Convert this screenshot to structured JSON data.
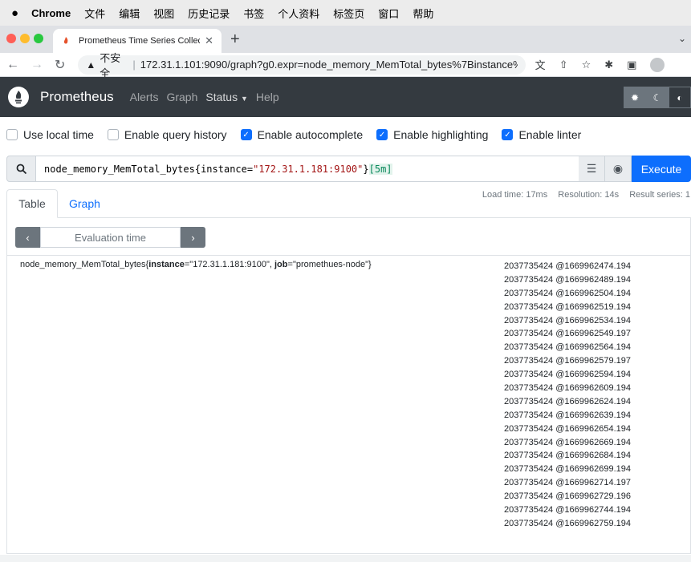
{
  "menubar": {
    "app": "Chrome",
    "items": [
      "文件",
      "编辑",
      "视图",
      "历史记录",
      "书签",
      "个人资料",
      "标签页",
      "窗口",
      "帮助"
    ]
  },
  "browser": {
    "tab_title": "Prometheus Time Series Collec",
    "security_label": "不安全",
    "url": "172.31.1.101:9090/graph?g0.expr=node_memory_MemTotal_bytes%7Binstance%3..."
  },
  "navbar": {
    "brand": "Prometheus",
    "links": {
      "alerts": "Alerts",
      "graph": "Graph",
      "status": "Status",
      "help": "Help"
    }
  },
  "options": {
    "use_local_time": {
      "label": "Use local time",
      "checked": false
    },
    "enable_query_history": {
      "label": "Enable query history",
      "checked": false
    },
    "enable_autocomplete": {
      "label": "Enable autocomplete",
      "checked": true
    },
    "enable_highlighting": {
      "label": "Enable highlighting",
      "checked": true
    },
    "enable_linter": {
      "label": "Enable linter",
      "checked": true
    }
  },
  "query": {
    "metric": "node_memory_MemTotal_bytes",
    "open_brace": "{",
    "label_name": "instance",
    "equals": "=",
    "label_value": "\"172.31.1.181:9100\"",
    "close_brace": "}",
    "range": "[5m]",
    "execute_label": "Execute"
  },
  "results": {
    "tabs": {
      "table": "Table",
      "graph": "Graph"
    },
    "load_time": "Load time: 17ms",
    "resolution": "Resolution: 14s",
    "result_series": "Result series: 1",
    "evaluation_placeholder": "Evaluation time",
    "series": {
      "metric": "node_memory_MemTotal_bytes",
      "instance_key": "instance",
      "instance_value": "\"172.31.1.181:9100\"",
      "job_key": "job",
      "job_value": "\"promethues-node\""
    },
    "samples": [
      "2037735424 @1669962474.194",
      "2037735424 @1669962489.194",
      "2037735424 @1669962504.194",
      "2037735424 @1669962519.194",
      "2037735424 @1669962534.194",
      "2037735424 @1669962549.197",
      "2037735424 @1669962564.194",
      "2037735424 @1669962579.197",
      "2037735424 @1669962594.194",
      "2037735424 @1669962609.194",
      "2037735424 @1669962624.194",
      "2037735424 @1669962639.194",
      "2037735424 @1669962654.194",
      "2037735424 @1669962669.194",
      "2037735424 @1669962684.194",
      "2037735424 @1669962699.194",
      "2037735424 @1669962714.197",
      "2037735424 @1669962729.196",
      "2037735424 @1669962744.194",
      "2037735424 @1669962759.194"
    ]
  },
  "colors": {
    "navbar_bg": "#343a40",
    "primary": "#0d6efd",
    "label_value": "#a31515"
  }
}
